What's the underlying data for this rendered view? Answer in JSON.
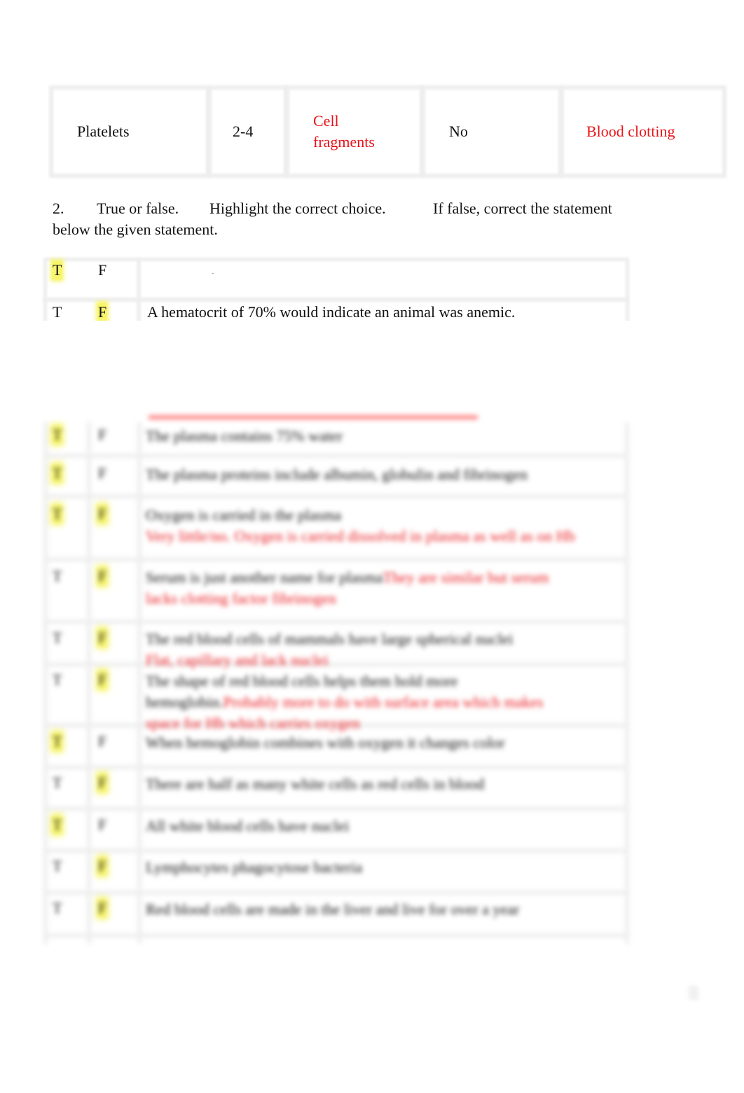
{
  "cell_table": {
    "row": [
      "Platelets",
      "2-4",
      "Cell fragments",
      "No",
      "Blood clotting"
    ],
    "cell_fragments_lines": [
      "Cell",
      "fragments"
    ]
  },
  "question": {
    "number": "2.",
    "part1": "True or false.",
    "part2": "Highlight the correct choice.",
    "part3": "If false, correct the statement",
    "line2": "below the given statement."
  },
  "tf": {
    "true_label": "T",
    "false_label": "F",
    "visible_rows": [
      {
        "highlight": "T",
        "statement": "",
        "mark": "-"
      },
      {
        "highlight": "F",
        "statement": "A hematocrit of 70% would indicate an animal was anemic."
      }
    ],
    "blurred_rows": [
      {
        "highlight": [
          "T"
        ],
        "statement": "The plasma contains 75% water",
        "correction": ""
      },
      {
        "highlight": [
          "T"
        ],
        "statement": "The plasma proteins include albumin, globulin and fibrinogen",
        "correction": ""
      },
      {
        "highlight": [
          "T",
          "F"
        ],
        "statement": "Oxygen is carried in the plasma",
        "correction": "Very little/no. Oxygen is carried dissolved in plasma as well as on Hb"
      },
      {
        "highlight": [
          "F"
        ],
        "statement": "Serum is just another name for plasma",
        "correction": "They are similar but serum lacks clotting factor fibrinogen"
      },
      {
        "highlight": [
          "F"
        ],
        "statement": "The red blood cells of mammals have large spherical nuclei",
        "correction": "Flat, capillary and lack nuclei"
      },
      {
        "highlight": [
          "F"
        ],
        "statement": "The shape of red blood cells helps them hold more hemoglobin.",
        "correction": "Probably more to do with surface area which makes space for Hb which carries oxygen"
      },
      {
        "highlight": [
          "T"
        ],
        "statement": "When hemoglobin combines with oxygen it changes color",
        "correction": ""
      },
      {
        "highlight": [
          "F"
        ],
        "statement": "There are half as many white cells as red cells in blood",
        "correction": ""
      },
      {
        "highlight": [
          "T"
        ],
        "statement": "All white blood cells have nuclei",
        "correction": ""
      },
      {
        "highlight": [
          "F"
        ],
        "statement": "Lymphocytes phagocytose bacteria",
        "correction": ""
      },
      {
        "highlight": [
          "F"
        ],
        "statement": "Red blood cells are made in the liver and live for over a year",
        "correction": ""
      }
    ]
  },
  "colors": {
    "highlight": "#f7f56a",
    "answer_red": "#e8141a"
  }
}
